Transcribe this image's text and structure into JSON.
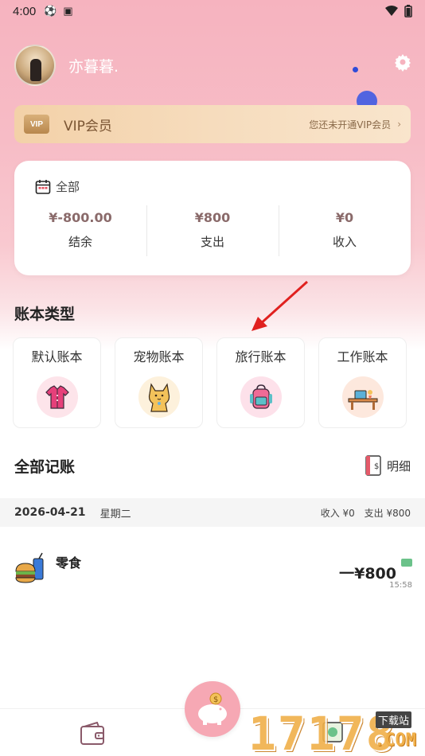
{
  "status_bar": {
    "time": "4:00"
  },
  "profile": {
    "username": "亦暮暮."
  },
  "vip": {
    "badge": "VIP",
    "title": "VIP会员",
    "subtitle": "您还未开通VIP会员"
  },
  "summary": {
    "period": "全部",
    "balance": {
      "amount": "¥-800.00",
      "label": "结余"
    },
    "expense": {
      "amount": "¥800",
      "label": "支出"
    },
    "income": {
      "amount": "¥0",
      "label": "收入"
    }
  },
  "book_types": {
    "title": "账本类型",
    "items": [
      {
        "label": "默认账本",
        "icon": "shirt-icon"
      },
      {
        "label": "宠物账本",
        "icon": "cat-icon"
      },
      {
        "label": "旅行账本",
        "icon": "backpack-icon"
      },
      {
        "label": "工作账本",
        "icon": "desk-icon"
      }
    ]
  },
  "records": {
    "title": "全部记账",
    "detail_label": "明细",
    "day": {
      "date": "2026-04-21",
      "weekday": "星期二",
      "income": "收入 ¥0",
      "expense": "支出 ¥800"
    },
    "items": [
      {
        "name": "零食",
        "amount": "一¥800",
        "time": "15:58",
        "icon": "snack-icon"
      }
    ]
  },
  "watermark": {
    "main": "17178",
    "tag": "下载站",
    "sub": ".COM"
  },
  "colors": {
    "hero_pink": "#f6b3bf",
    "vip_gold": "#f3d1a8",
    "fab_pink": "#f6a8b4",
    "amount_brown": "#8a6a6a"
  }
}
